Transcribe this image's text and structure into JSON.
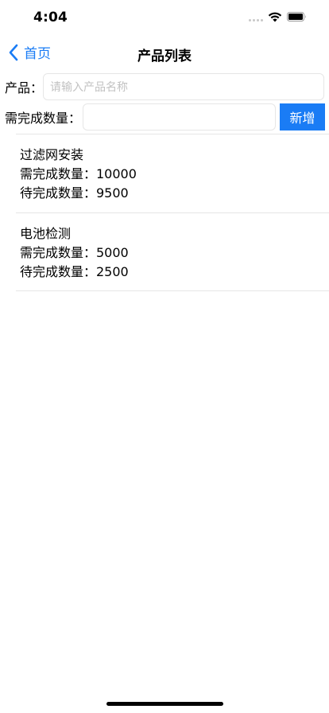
{
  "status_bar": {
    "time": "4:04"
  },
  "nav": {
    "back_label": "首页",
    "title": "产品列表"
  },
  "form": {
    "product_label": "产品：",
    "product_placeholder": "请输入产品名称",
    "quantity_label": "需完成数量：",
    "quantity_value": "",
    "add_button_label": "新增"
  },
  "products": [
    {
      "name": "过滤网安装",
      "required": "需完成数量：10000",
      "pending": "待完成数量：9500"
    },
    {
      "name": "电池检测",
      "required": "需完成数量：5000",
      "pending": "待完成数量：2500"
    }
  ],
  "colors": {
    "accent": "#1a7cf5",
    "divider": "#e6e6e6",
    "placeholder": "#c2c2c2"
  },
  "icons": {
    "back": "chevron-left-icon",
    "wifi": "wifi-icon",
    "battery": "battery-icon",
    "signal": "signal-dots-icon"
  }
}
